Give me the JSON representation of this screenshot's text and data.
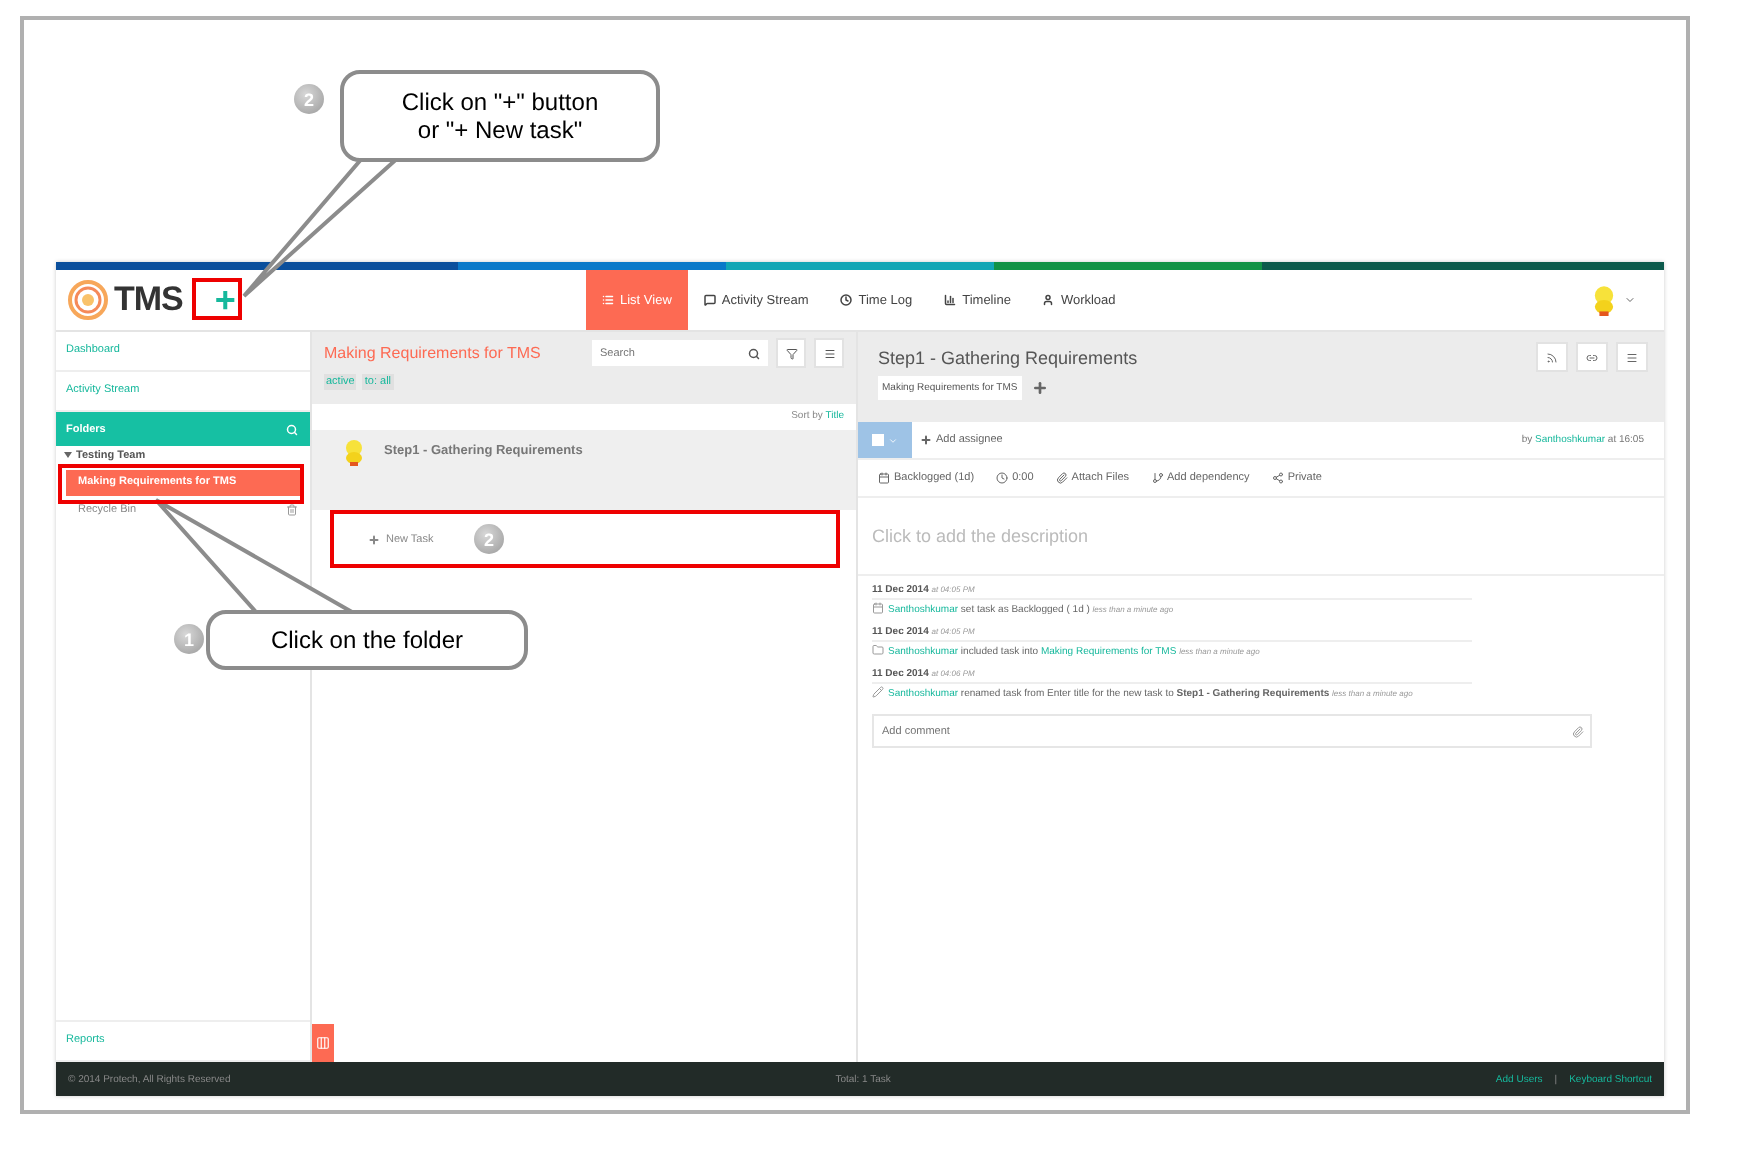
{
  "header": {
    "brand": "TMS",
    "add_button": "+",
    "tabs": [
      {
        "label": "List View",
        "selected": true
      },
      {
        "label": "Activity Stream",
        "selected": false
      },
      {
        "label": "Time Log",
        "selected": false
      },
      {
        "label": "Timeline",
        "selected": false
      },
      {
        "label": "Workload",
        "selected": false
      }
    ]
  },
  "sidebar": {
    "items": [
      {
        "label": "Dashboard"
      },
      {
        "label": "Activity Stream"
      }
    ],
    "folders_title": "Folders",
    "tree": [
      {
        "label": "Testing Team",
        "expanded": true,
        "children": [
          {
            "label": "Making Requirements for TMS",
            "selected": true
          }
        ]
      }
    ],
    "recycle_bin": "Recycle Bin",
    "reports": "Reports"
  },
  "list": {
    "title": "Making Requirements for TMS",
    "search": {
      "placeholder": "Search"
    },
    "filters": [
      "active",
      "to: all"
    ],
    "sort_label": "Sort by",
    "sort_value": "Title",
    "tasks": [
      {
        "title": "Step1 - Gathering Requirements"
      }
    ],
    "new_task": "New Task"
  },
  "task": {
    "title": "Step1 - Gathering Requirements",
    "folder_tag": "Making Requirements for TMS",
    "add_assignee": "Add assignee",
    "by_label": "by",
    "author": "Santhoshkumar",
    "created": "at 16:05",
    "meta": [
      "Backlogged (1d)",
      "0:00",
      "Attach Files",
      "Add dependency",
      "Private"
    ],
    "description_placeholder": "Click to add the description",
    "activity": [
      {
        "date": "11 Dec 2014",
        "time": "at 04:05 PM",
        "user": "Santhoshkumar",
        "action": "set task as Backlogged ( 1d )",
        "ago": "less than a minute ago"
      },
      {
        "date": "11 Dec 2014",
        "time": "at 04:05 PM",
        "user": "Santhoshkumar",
        "action": "included task into",
        "link": "Making Requirements for TMS",
        "ago": "less than a minute ago"
      },
      {
        "date": "11 Dec 2014",
        "time": "at 04:06 PM",
        "user": "Santhoshkumar",
        "action": "renamed task from Enter title for the new task to **Step1 - Gathering Requirements**",
        "ago": "less than a minute ago"
      }
    ],
    "comment_placeholder": "Add comment"
  },
  "footer": {
    "copyright": "© 2014 Protech, All Rights Reserved",
    "total": "Total: 1 Task",
    "links": [
      "Add Users",
      "Keyboard Shortcut"
    ],
    "separator": "|"
  },
  "callouts": [
    {
      "kind": "top",
      "step": "2",
      "text": "Click on \"+\" button\nor \"+ New task\""
    },
    {
      "kind": "bottom",
      "step": "1",
      "text": "Click on the folder"
    }
  ],
  "step_badges": [
    {
      "kind": "newtask",
      "step": "2"
    }
  ]
}
